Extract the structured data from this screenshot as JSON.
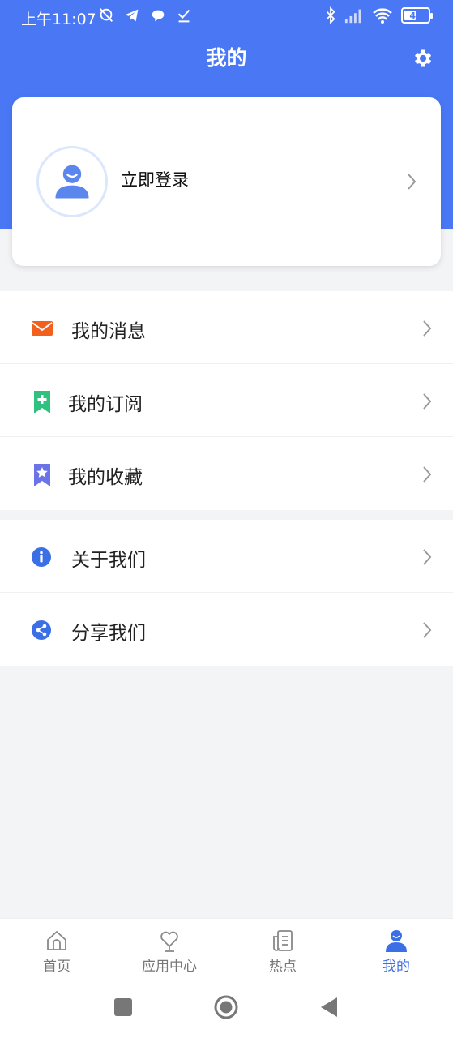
{
  "status_bar": {
    "time": "上午11:07",
    "battery_level": "45"
  },
  "header": {
    "title": "我的"
  },
  "login_card": {
    "label": "立即登录"
  },
  "menu_section_1": [
    {
      "label": "我的消息",
      "icon": "mail-icon",
      "color": "#f2601e"
    },
    {
      "label": "我的订阅",
      "icon": "bookmark-plus-icon",
      "color": "#2ec27e"
    },
    {
      "label": "我的收藏",
      "icon": "bookmark-star-icon",
      "color": "#6b73e6"
    }
  ],
  "menu_section_2": [
    {
      "label": "关于我们",
      "icon": "info-icon",
      "color": "#3b6fe6"
    },
    {
      "label": "分享我们",
      "icon": "share-icon",
      "color": "#3b6fe6"
    }
  ],
  "bottom_nav": [
    {
      "label": "首页",
      "icon": "home-icon",
      "active": false
    },
    {
      "label": "应用中心",
      "icon": "heart-icon",
      "active": false
    },
    {
      "label": "热点",
      "icon": "news-icon",
      "active": false
    },
    {
      "label": "我的",
      "icon": "user-icon",
      "active": true
    }
  ],
  "colors": {
    "primary": "#4a78f5",
    "active_tab": "#3b6fe6",
    "background": "#f3f4f6"
  }
}
